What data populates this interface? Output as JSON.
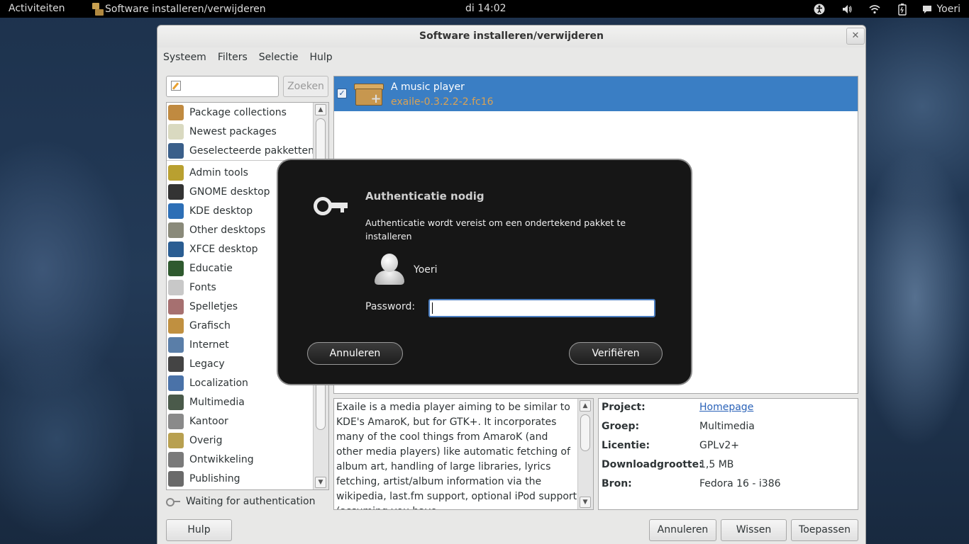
{
  "topbar": {
    "activities": "Activiteiten",
    "app_name": "Software installeren/verwijderen",
    "clock": "di 14:02",
    "user": "Yoeri",
    "tray_icons": [
      "accessibility-icon",
      "volume-icon",
      "wifi-icon",
      "battery-icon",
      "chat-icon"
    ]
  },
  "window": {
    "title": "Software installeren/verwijderen",
    "close_glyph": "✕",
    "menus": [
      "Systeem",
      "Filters",
      "Selectie",
      "Hulp"
    ],
    "search": {
      "value": "",
      "button": "Zoeken"
    },
    "groups": [
      {
        "label": "Package collections",
        "icon": "package-collections-icon",
        "color": "#c08a40"
      },
      {
        "label": "Newest packages",
        "icon": "lightbulb-icon",
        "color": "#d9d9c0"
      },
      {
        "label": "Geselecteerde pakketten",
        "icon": "magnifier-icon",
        "color": "#3a5f8a"
      },
      {
        "label": "Admin tools",
        "icon": "admin-tools-icon",
        "color": "#b9a030"
      },
      {
        "label": "GNOME desktop",
        "icon": "gnome-foot-icon",
        "color": "#333333"
      },
      {
        "label": "KDE desktop",
        "icon": "kde-icon",
        "color": "#2d6fb6"
      },
      {
        "label": "Other desktops",
        "icon": "desktop-icon",
        "color": "#8a8a7a"
      },
      {
        "label": "XFCE desktop",
        "icon": "xfce-icon",
        "color": "#2a5d92"
      },
      {
        "label": "Educatie",
        "icon": "education-icon",
        "color": "#2f5a2f"
      },
      {
        "label": "Fonts",
        "icon": "fonts-icon",
        "color": "#c8c8c8"
      },
      {
        "label": "Spelletjes",
        "icon": "games-icon",
        "color": "#a67070"
      },
      {
        "label": "Grafisch",
        "icon": "graphics-icon",
        "color": "#c09040"
      },
      {
        "label": "Internet",
        "icon": "internet-icon",
        "color": "#5a7ea8"
      },
      {
        "label": "Legacy",
        "icon": "legacy-icon",
        "color": "#444444"
      },
      {
        "label": "Localization",
        "icon": "localization-icon",
        "color": "#4a72a8"
      },
      {
        "label": "Multimedia",
        "icon": "multimedia-icon",
        "color": "#4a5a4a"
      },
      {
        "label": "Kantoor",
        "icon": "office-icon",
        "color": "#8a8a8a"
      },
      {
        "label": "Overig",
        "icon": "other-icon",
        "color": "#b8a050"
      },
      {
        "label": "Ontwikkeling",
        "icon": "development-icon",
        "color": "#7a7a7a"
      },
      {
        "label": "Publishing",
        "icon": "publishing-icon",
        "color": "#6a6a6a"
      }
    ],
    "status": "Waiting for authentication",
    "package": {
      "checked": "✓",
      "summary": "A music player",
      "name": "exaile-0.3.2.2-2.fc16",
      "selected_color": "#3a7ec4"
    },
    "description": "Exaile is a media player aiming to be similar to KDE's AmaroK, but for GTK+. It incorporates many of the cool things from AmaroK (and other media players) like automatic fetching of album art, handling of large libraries, lyrics fetching, artist/album information via the wikipedia, last.fm support, optional iPod support (assuming you have",
    "details": [
      {
        "label": "Project:",
        "value": "Homepage",
        "link": true
      },
      {
        "label": "Groep:",
        "value": "Multimedia"
      },
      {
        "label": "Licentie:",
        "value": "GPLv2+"
      },
      {
        "label": "Downloadgrootte:",
        "value": "1,5 MB"
      },
      {
        "label": "Bron:",
        "value": "Fedora 16 - i386"
      }
    ],
    "buttons": {
      "help": "Hulp",
      "cancel": "Annuleren",
      "clear": "Wissen",
      "apply": "Toepassen"
    }
  },
  "auth": {
    "title": "Authenticatie nodig",
    "message": "Authenticatie wordt vereist om een ondertekend pakket te installeren",
    "username": "Yoeri",
    "password_label": "Password:",
    "password_value": "",
    "cancel": "Annuleren",
    "verify": "Verifiëren"
  }
}
